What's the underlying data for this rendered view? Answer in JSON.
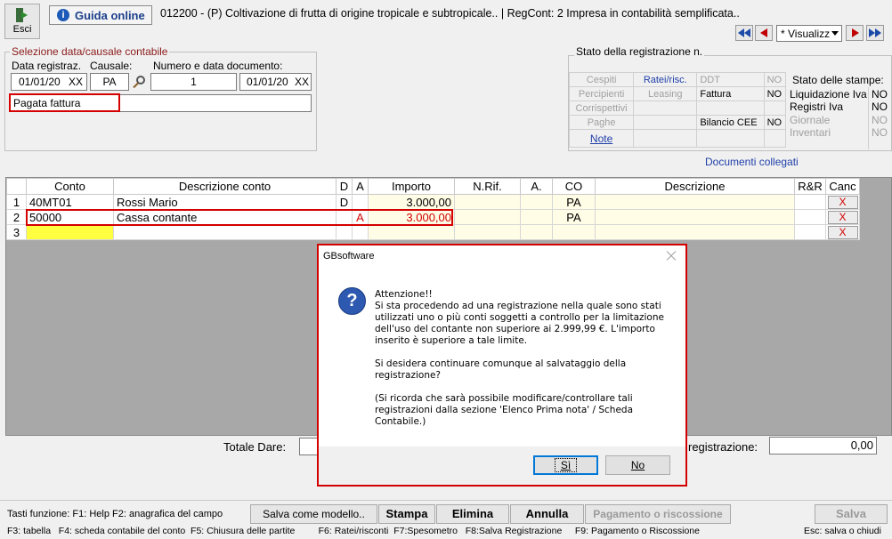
{
  "toolbar": {
    "exit_label": "Esci",
    "guide_label": "Guida online",
    "title": "012200 - (P) Coltivazione di frutta di origine tropicale e subtropicale.. | RegCont: 2 Impresa  in contabilità semplificata..",
    "view_select": "* Visualizz"
  },
  "selection": {
    "group_title": "Selezione data/causale contabile",
    "date_label": "Data registraz.",
    "date_value": "01/01/20",
    "date_suffix": "XX",
    "causale_label": "Causale:",
    "causale_value": "PA",
    "doc_label": "Numero e data documento:",
    "doc_number": "1",
    "doc_date": "01/01/20",
    "doc_date_suffix": "XX",
    "desc_value": "Pagata fattura"
  },
  "status": {
    "group_title": "Stato della registrazione n.",
    "col1": [
      "Cespiti",
      "Percipienti",
      "Corrispettivi",
      "Paghe",
      "Note"
    ],
    "col2": [
      "Ratei/risc.",
      "Leasing",
      "",
      "",
      ""
    ],
    "col3": [
      "DDT",
      "Fattura",
      "",
      "Bilancio CEE",
      ""
    ],
    "col4": [
      "NO",
      "NO",
      "",
      "NO",
      ""
    ],
    "print_title": "Stato delle stampe:",
    "print_items": [
      "Liquidazione Iva",
      "Registri Iva",
      "Giornale",
      "Inventari"
    ],
    "print_values": [
      "NO",
      "NO",
      "NO",
      "NO"
    ],
    "linked_docs": "Documenti collegati"
  },
  "grid": {
    "headers": [
      "Conto",
      "Descrizione conto",
      "D",
      "A",
      "Importo",
      "N.Rif.",
      "A.",
      "CO",
      "Descrizione",
      "R&R",
      "Canc"
    ],
    "rows": [
      {
        "n": "1",
        "conto": "40MT01",
        "descr": "Rossi Mario",
        "d": "D",
        "a": "",
        "importo": "3.000,00",
        "nrif": "",
        "a2": "",
        "co": "PA",
        "descr2": "",
        "canc": "X"
      },
      {
        "n": "2",
        "conto": "50000",
        "descr": "Cassa contante",
        "d": "",
        "a": "A",
        "importo": "3.000,00",
        "nrif": "",
        "a2": "",
        "co": "PA",
        "descr2": "",
        "canc": "X"
      },
      {
        "n": "3",
        "conto": "",
        "descr": "",
        "d": "",
        "a": "",
        "importo": "",
        "nrif": "",
        "a2": "",
        "co": "",
        "descr2": "",
        "canc": "X"
      }
    ]
  },
  "totals": {
    "dare_label": "Totale Dare:",
    "reg_label": "registrazione:",
    "reg_value": "0,00"
  },
  "dialog": {
    "title": "GBsoftware",
    "p1": "Attenzione!!\nSi sta procedendo ad una registrazione nella quale sono stati utilizzati uno o più conti soggetti a controllo per la limitazione dell'uso del contante non superiore ai 2.999,99 €. L'importo inserito è superiore a tale limite.",
    "p2": "Si desidera continuare comunque al salvataggio della registrazione?",
    "p3": "(Si ricorda che sarà possibile modificare/controllare tali registrazioni dalla sezione 'Elenco Prima nota' / Scheda Contabile.)",
    "yes": "Sì",
    "no": "No"
  },
  "footer": {
    "keys_label": "Tasti funzione:  F1: Help  F2: anagrafica del campo",
    "save_model": "Salva come modello..",
    "print": "Stampa",
    "delete": "Elimina",
    "cancel": "Annulla",
    "payment": "Pagamento o riscossione",
    "save": "Salva",
    "keys_line2": "F3: tabella   F4: scheda contabile del conto  F5: Chiusura delle partite         F6: Ratei/risconti  F7:Spesometro   F8:Salva Registrazione     F9: Pagamento o Riscossione",
    "esc_hint": "Esc: salva o chiudi"
  },
  "colors": {
    "accent_red": "#d40000",
    "link_blue": "#1f3ea8"
  }
}
